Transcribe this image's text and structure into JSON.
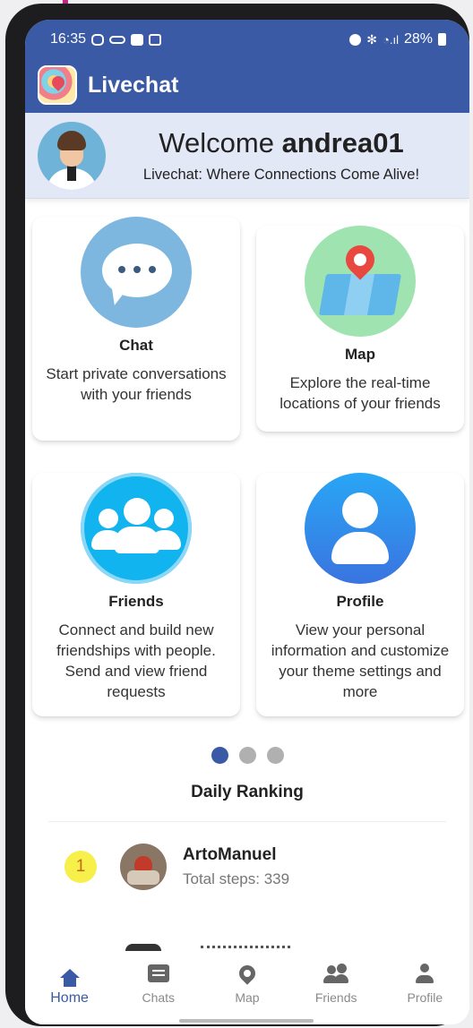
{
  "status_bar": {
    "time": "16:35",
    "battery": "28%"
  },
  "app_bar": {
    "title": "Livechat"
  },
  "welcome": {
    "greeting": "Welcome",
    "username": "andrea01",
    "tagline": "Livechat: Where Connections Come Alive!"
  },
  "cards": {
    "chat": {
      "title": "Chat",
      "description": "Start private conversations with your friends"
    },
    "map": {
      "title": "Map",
      "description": "Explore the real-time locations of your friends"
    },
    "friends": {
      "title": "Friends",
      "description": "Connect and build new friendships with people. Send and view friend requests"
    },
    "profile": {
      "title": "Profile",
      "description": "View your personal information and customize your theme settings and more"
    }
  },
  "pager": {
    "active_page": 1,
    "total_pages": 3
  },
  "ranking": {
    "title": "Daily Ranking",
    "entries": [
      {
        "rank": "1",
        "name": "ArtoManuel",
        "steps": "Total steps: 339"
      }
    ]
  },
  "bottom_nav": {
    "items": [
      {
        "label": "Home",
        "icon": "home-icon"
      },
      {
        "label": "Chats",
        "icon": "chat-bubble-icon"
      },
      {
        "label": "Map",
        "icon": "map-pin-icon"
      },
      {
        "label": "Friends",
        "icon": "people-icon"
      },
      {
        "label": "Profile",
        "icon": "person-icon"
      }
    ]
  },
  "colors": {
    "primary": "#3a5aa6",
    "welcome_bg": "#e2e8f6",
    "rank_badge": "#f7ef4a",
    "inactive_nav": "#8a8a8a"
  }
}
